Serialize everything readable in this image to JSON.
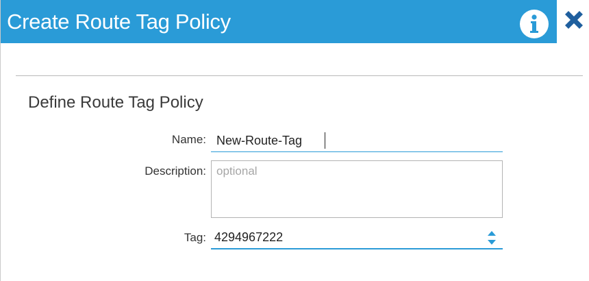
{
  "dialog": {
    "title": "Create Route Tag Policy",
    "accent_color": "#2a9bd7",
    "info_icon": "info-icon",
    "close_icon": "close-icon"
  },
  "form": {
    "section_title": "Define Route Tag Policy",
    "name": {
      "label": "Name:",
      "value": "New-Route-Tag"
    },
    "description": {
      "label": "Description:",
      "value": "",
      "placeholder": "optional"
    },
    "tag": {
      "label": "Tag:",
      "value": "4294967222",
      "stepper_icon": "up-down-stepper-icon"
    }
  }
}
